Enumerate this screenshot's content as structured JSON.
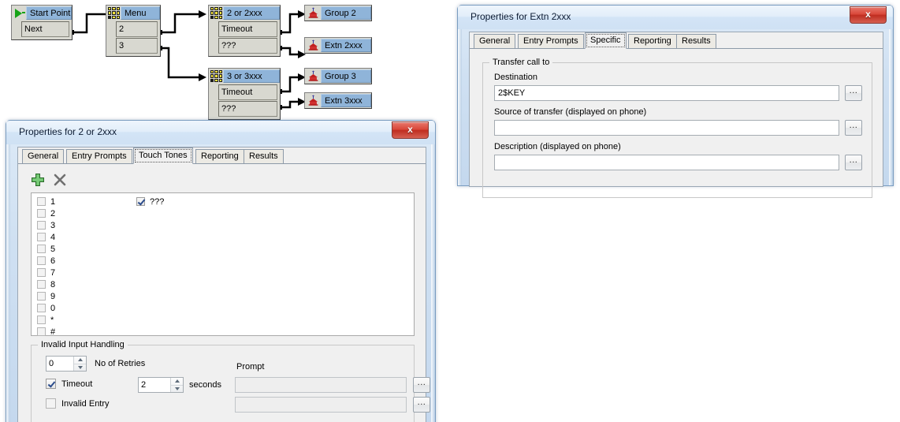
{
  "flowchart": {
    "nodes": [
      {
        "id": "start-point",
        "icon": "play-icon",
        "title": "Start Point",
        "rows": [
          "Next"
        ]
      },
      {
        "id": "menu",
        "icon": "keypad-icon",
        "title": "Menu",
        "rows": [
          "2",
          "3"
        ]
      },
      {
        "id": "action-2-or-2xxx",
        "icon": "keypad-icon",
        "title": "2 or 2xxx",
        "rows": [
          "Timeout",
          "???"
        ]
      },
      {
        "id": "action-3-or-3xxx",
        "icon": "keypad-icon",
        "title": "3 or 3xxx",
        "rows": [
          "Timeout",
          "???"
        ]
      },
      {
        "id": "group-2",
        "icon": "phone-icon",
        "title": "Group 2",
        "rows": []
      },
      {
        "id": "extn-2xxx",
        "icon": "phone-icon",
        "title": "Extn 2xxx",
        "rows": []
      },
      {
        "id": "group-3",
        "icon": "phone-icon",
        "title": "Group 3",
        "rows": []
      },
      {
        "id": "extn-3xxx",
        "icon": "phone-icon",
        "title": "Extn 3xxx",
        "rows": []
      }
    ]
  },
  "dialog_left": {
    "title": "Properties for 2 or 2xxx",
    "close_label": "x",
    "tabs": [
      {
        "label": "General",
        "active": false
      },
      {
        "label": "Entry Prompts",
        "active": false
      },
      {
        "label": "Touch Tones",
        "active": true
      },
      {
        "label": "Reporting",
        "active": false
      },
      {
        "label": "Results",
        "active": false
      }
    ],
    "toolbar": {
      "add_icon": "plus-icon",
      "delete_icon": "delete-x-icon"
    },
    "tone_list": [
      {
        "key": "1",
        "checked": false
      },
      {
        "key": "2",
        "checked": false
      },
      {
        "key": "3",
        "checked": false
      },
      {
        "key": "4",
        "checked": false
      },
      {
        "key": "5",
        "checked": false
      },
      {
        "key": "6",
        "checked": false
      },
      {
        "key": "7",
        "checked": false
      },
      {
        "key": "8",
        "checked": false
      },
      {
        "key": "9",
        "checked": false
      },
      {
        "key": "0",
        "checked": false
      },
      {
        "key": "*",
        "checked": false
      },
      {
        "key": "#",
        "checked": false
      }
    ],
    "tone_list_right": [
      {
        "key": "???",
        "checked": true
      }
    ],
    "invalid_input": {
      "legend": "Invalid Input Handling",
      "retries_value": "0",
      "retries_label": "No of Retries",
      "prompt_label": "Prompt",
      "timeout_label": "Timeout",
      "timeout_checked": true,
      "timeout_value": "2",
      "seconds_label": "seconds",
      "timeout_prompt_value": "",
      "invalid_entry_label": "Invalid Entry",
      "invalid_entry_checked": false,
      "invalid_entry_prompt_value": "",
      "browse_label": "..."
    }
  },
  "dialog_right": {
    "title": "Properties for Extn 2xxx",
    "close_label": "x",
    "tabs": [
      {
        "label": "General",
        "active": false
      },
      {
        "label": "Entry Prompts",
        "active": false
      },
      {
        "label": "Specific",
        "active": true
      },
      {
        "label": "Reporting",
        "active": false
      },
      {
        "label": "Results",
        "active": false
      }
    ],
    "transfer": {
      "legend": "Transfer call to",
      "destination_label": "Destination",
      "destination_value": "2$KEY",
      "source_label": "Source of transfer (displayed on phone)",
      "source_value": "",
      "description_label": "Description (displayed on phone)",
      "description_value": "",
      "browse_label": "..."
    }
  },
  "colors": {
    "node_title_bg": "#8fb4d9",
    "node_bg": "#d8d8d0",
    "close_red": "#c33425",
    "title_blue": "#d3e4f6",
    "keypad_yellow": "#f5e23c"
  }
}
